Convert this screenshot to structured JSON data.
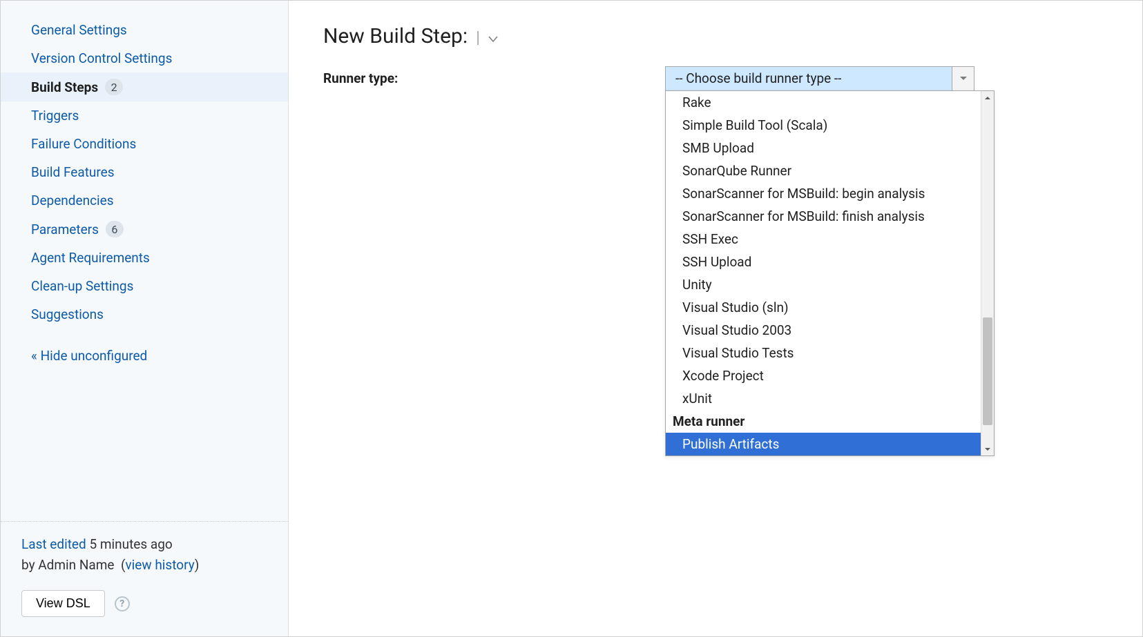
{
  "sidebar": {
    "items": [
      {
        "label": "General Settings",
        "active": false,
        "badge": null,
        "name": "sidebar-item-general-settings"
      },
      {
        "label": "Version Control Settings",
        "active": false,
        "badge": null,
        "name": "sidebar-item-vcs"
      },
      {
        "label": "Build Steps",
        "active": true,
        "badge": "2",
        "name": "sidebar-item-build-steps"
      },
      {
        "label": "Triggers",
        "active": false,
        "badge": null,
        "name": "sidebar-item-triggers"
      },
      {
        "label": "Failure Conditions",
        "active": false,
        "badge": null,
        "name": "sidebar-item-failure-conditions"
      },
      {
        "label": "Build Features",
        "active": false,
        "badge": null,
        "name": "sidebar-item-build-features"
      },
      {
        "label": "Dependencies",
        "active": false,
        "badge": null,
        "name": "sidebar-item-dependencies"
      },
      {
        "label": "Parameters",
        "active": false,
        "badge": "6",
        "name": "sidebar-item-parameters"
      },
      {
        "label": "Agent Requirements",
        "active": false,
        "badge": null,
        "name": "sidebar-item-agent-requirements"
      },
      {
        "label": "Clean-up Settings",
        "active": false,
        "badge": null,
        "name": "sidebar-item-cleanup"
      },
      {
        "label": "Suggestions",
        "active": false,
        "badge": null,
        "name": "sidebar-item-suggestions"
      }
    ],
    "hide_unconfigured_label": "« Hide unconfigured",
    "last_edited": {
      "prefix": "Last edited",
      "time": "5 minutes ago",
      "by_prefix": "by",
      "by_name": "Admin Name",
      "view_history_label": "view history"
    },
    "view_dsl_label": "View DSL"
  },
  "main": {
    "title": "New Build Step:",
    "form": {
      "runner_type_label": "Runner type:",
      "runner_type_placeholder": "-- Choose build runner type --"
    },
    "dropdown": {
      "options": [
        {
          "type": "option",
          "label": "Rake"
        },
        {
          "type": "option",
          "label": "Simple Build Tool (Scala)"
        },
        {
          "type": "option",
          "label": "SMB Upload"
        },
        {
          "type": "option",
          "label": "SonarQube Runner"
        },
        {
          "type": "option",
          "label": "SonarScanner for MSBuild: begin analysis"
        },
        {
          "type": "option",
          "label": "SonarScanner for MSBuild: finish analysis"
        },
        {
          "type": "option",
          "label": "SSH Exec"
        },
        {
          "type": "option",
          "label": "SSH Upload"
        },
        {
          "type": "option",
          "label": "Unity"
        },
        {
          "type": "option",
          "label": "Visual Studio (sln)"
        },
        {
          "type": "option",
          "label": "Visual Studio 2003"
        },
        {
          "type": "option",
          "label": "Visual Studio Tests"
        },
        {
          "type": "option",
          "label": "Xcode Project"
        },
        {
          "type": "option",
          "label": "xUnit"
        },
        {
          "type": "group",
          "label": "Meta runner"
        },
        {
          "type": "option",
          "label": "Publish Artifacts",
          "selected": true
        }
      ]
    }
  }
}
